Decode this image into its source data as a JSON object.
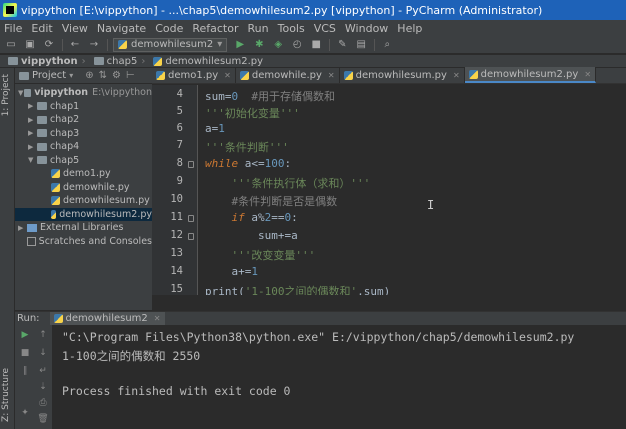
{
  "window": {
    "title": "vippython [E:\\vippython] - ...\\chap5\\demowhilesum2.py [vippython] - PyCharm (Administrator)"
  },
  "menu": [
    "File",
    "Edit",
    "View",
    "Navigate",
    "Code",
    "Refactor",
    "Run",
    "Tools",
    "VCS",
    "Window",
    "Help"
  ],
  "toolbar": {
    "run_config": "demowhilesum2"
  },
  "breadcrumb": [
    "vippython",
    "chap5",
    "demowhilesum2.py"
  ],
  "left_strip": {
    "project_label": "1: Project",
    "structure_label": "Z: Structure"
  },
  "project_panel": {
    "title": "Project",
    "root": {
      "name": "vippython",
      "path": "E:\\vippython"
    },
    "folders": [
      "chap1",
      "chap2",
      "chap3",
      "chap4",
      "chap5"
    ],
    "chap5_files": [
      "demo1.py",
      "demowhile.py",
      "demowhilesum.py",
      "demowhilesum2.py"
    ],
    "external": "External Libraries",
    "scratches": "Scratches and Consoles"
  },
  "editor": {
    "tabs": [
      "demo1.py",
      "demowhile.py",
      "demowhilesum.py",
      "demowhilesum2.py"
    ],
    "line_numbers": [
      "4",
      "5",
      "6",
      "7",
      "8",
      "9",
      "10",
      "11",
      "12",
      "13",
      "14",
      "15"
    ]
  },
  "run": {
    "label": "Run:",
    "tab": "demowhilesum2",
    "output": [
      "\"C:\\Program Files\\Python38\\python.exe\" E:/vippython/chap5/demowhilesum2.py",
      "1-100之间的偶数和 2550",
      "",
      "Process finished with exit code 0"
    ]
  },
  "colors": {
    "accent": "#1e62b8",
    "selection": "#0d293e",
    "keyword": "#cc7832",
    "string": "#6a8759",
    "number": "#6897bb",
    "comment": "#808080"
  },
  "icons": [
    "pycharm-icon",
    "save-icon",
    "sync-icon",
    "back-icon",
    "forward-icon",
    "run-icon",
    "debug-icon",
    "coverage-icon",
    "profile-icon",
    "stop-icon",
    "wrench-icon",
    "search-icon",
    "folder-icon",
    "python-file-icon",
    "settings-icon",
    "collapse-icon",
    "gear-icon",
    "hide-icon",
    "rerun-icon",
    "up-icon",
    "down-icon",
    "wrap-icon",
    "print-icon",
    "trash-icon",
    "pin-icon"
  ]
}
